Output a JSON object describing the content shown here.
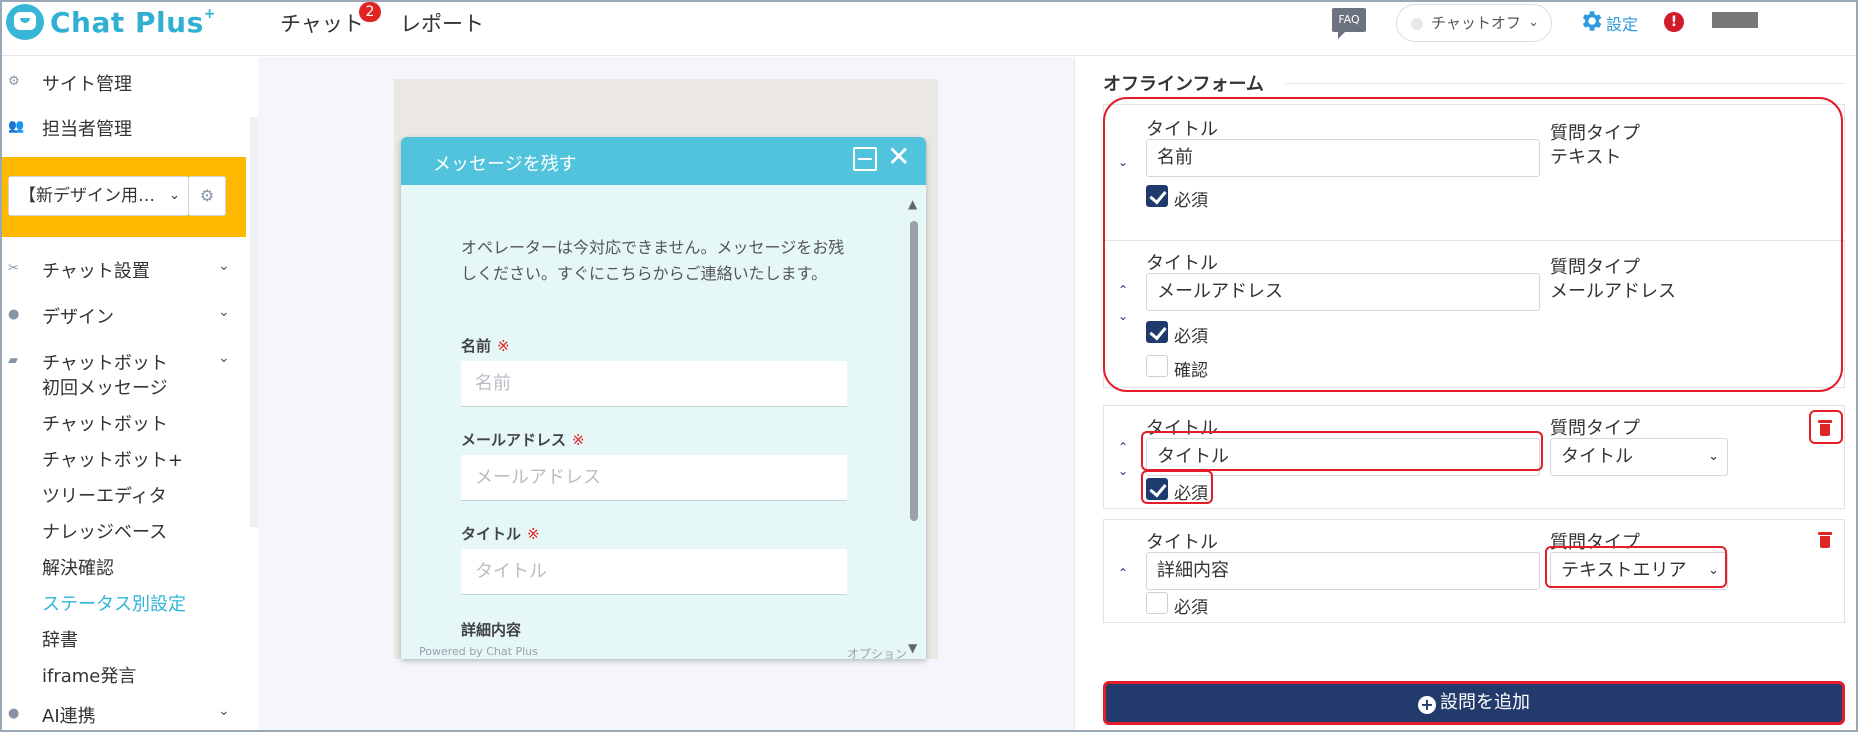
{
  "header": {
    "logo": "Chat Plus",
    "logo_sup": "+",
    "nav": [
      {
        "label": "チャット",
        "badge": "2"
      },
      {
        "label": "レポート"
      }
    ],
    "faq": "FAQ",
    "chat_status": "チャットオフ",
    "settings": "設定",
    "alert": "!"
  },
  "sidebar": {
    "items_top": [
      {
        "label": "サイト管理",
        "icon": "gear-icon"
      },
      {
        "label": "担当者管理",
        "icon": "users-icon"
      }
    ],
    "site_select": "【新デザイン用…",
    "sections": [
      {
        "label": "チャット設置",
        "icon": "tools-icon"
      },
      {
        "label": "デザイン",
        "icon": "palette-icon"
      },
      {
        "label": "チャットボット",
        "icon": "chat-icon"
      }
    ],
    "sub_items": [
      "初回メッセージ",
      "チャットボット",
      "チャットボット+",
      "ツリーエディタ",
      "ナレッジベース",
      "解決確認",
      "ステータス別設定",
      "辞書",
      "iframe発言"
    ],
    "active_sub": "ステータス別設定",
    "bottom": {
      "label": "AI連携",
      "icon": "bulb-icon"
    }
  },
  "preview": {
    "title": "メッセージを残す",
    "message": "オペレーターは今対応できません。メッセージをお残しください。すぐにこちらからご連絡いたします。",
    "fields": [
      {
        "label": "名前",
        "required": "※",
        "placeholder": "名前"
      },
      {
        "label": "メールアドレス",
        "required": "※",
        "placeholder": "メールアドレス"
      },
      {
        "label": "タイトル",
        "required": "※",
        "placeholder": "タイトル"
      },
      {
        "label": "詳細内容",
        "required": "",
        "placeholder": ""
      }
    ],
    "footer": "Powered by Chat Plus",
    "option": "オプション"
  },
  "form": {
    "title": "オフラインフォーム",
    "title_label": "タイトル",
    "type_label": "質問タイプ",
    "required_label": "必須",
    "confirm_label": "確認",
    "questions": [
      {
        "title": "名前",
        "type": "テキスト",
        "required": true
      },
      {
        "title": "メールアドレス",
        "type": "メールアドレス",
        "required": true,
        "confirm": false
      },
      {
        "title": "タイトル",
        "type": "タイトル",
        "required": true
      },
      {
        "title": "詳細内容",
        "type": "テキストエリア",
        "required": false
      }
    ],
    "add_button": "設問を追加",
    "colors": {
      "accent": "#223a6c",
      "highlight": "#e31d2a",
      "brand": "#2fb0d3"
    }
  }
}
